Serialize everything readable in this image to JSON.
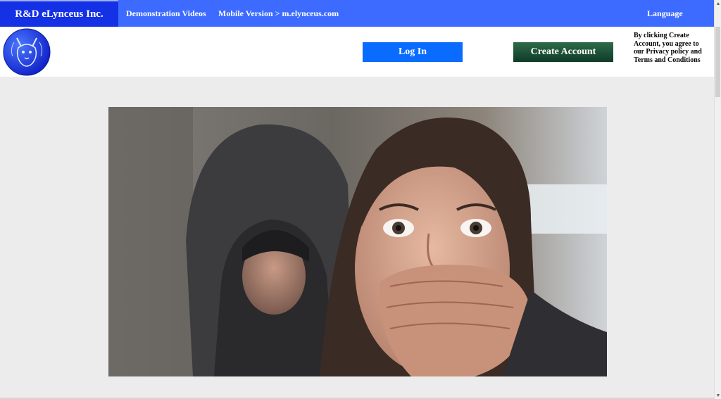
{
  "topbar": {
    "brand": "R&D eLynceus Inc.",
    "nav": {
      "videos": "Demonstration Videos",
      "mobile": "Mobile Version > m.elynceus.com",
      "language": "Language"
    }
  },
  "header": {
    "login_label": "Log In",
    "create_label": "Create Account",
    "terms_text": "By clicking Create Account, you agree to our Privacy policy and Terms and Conditions"
  },
  "colors": {
    "topbar": "#3d6bff",
    "brand_bg": "#1531e5",
    "login": "#0a6bff",
    "create": "#1f5a3a",
    "page_bg": "#ececec"
  },
  "icons": {
    "logo": "lynx-logo-icon",
    "hero": "hero-image"
  }
}
